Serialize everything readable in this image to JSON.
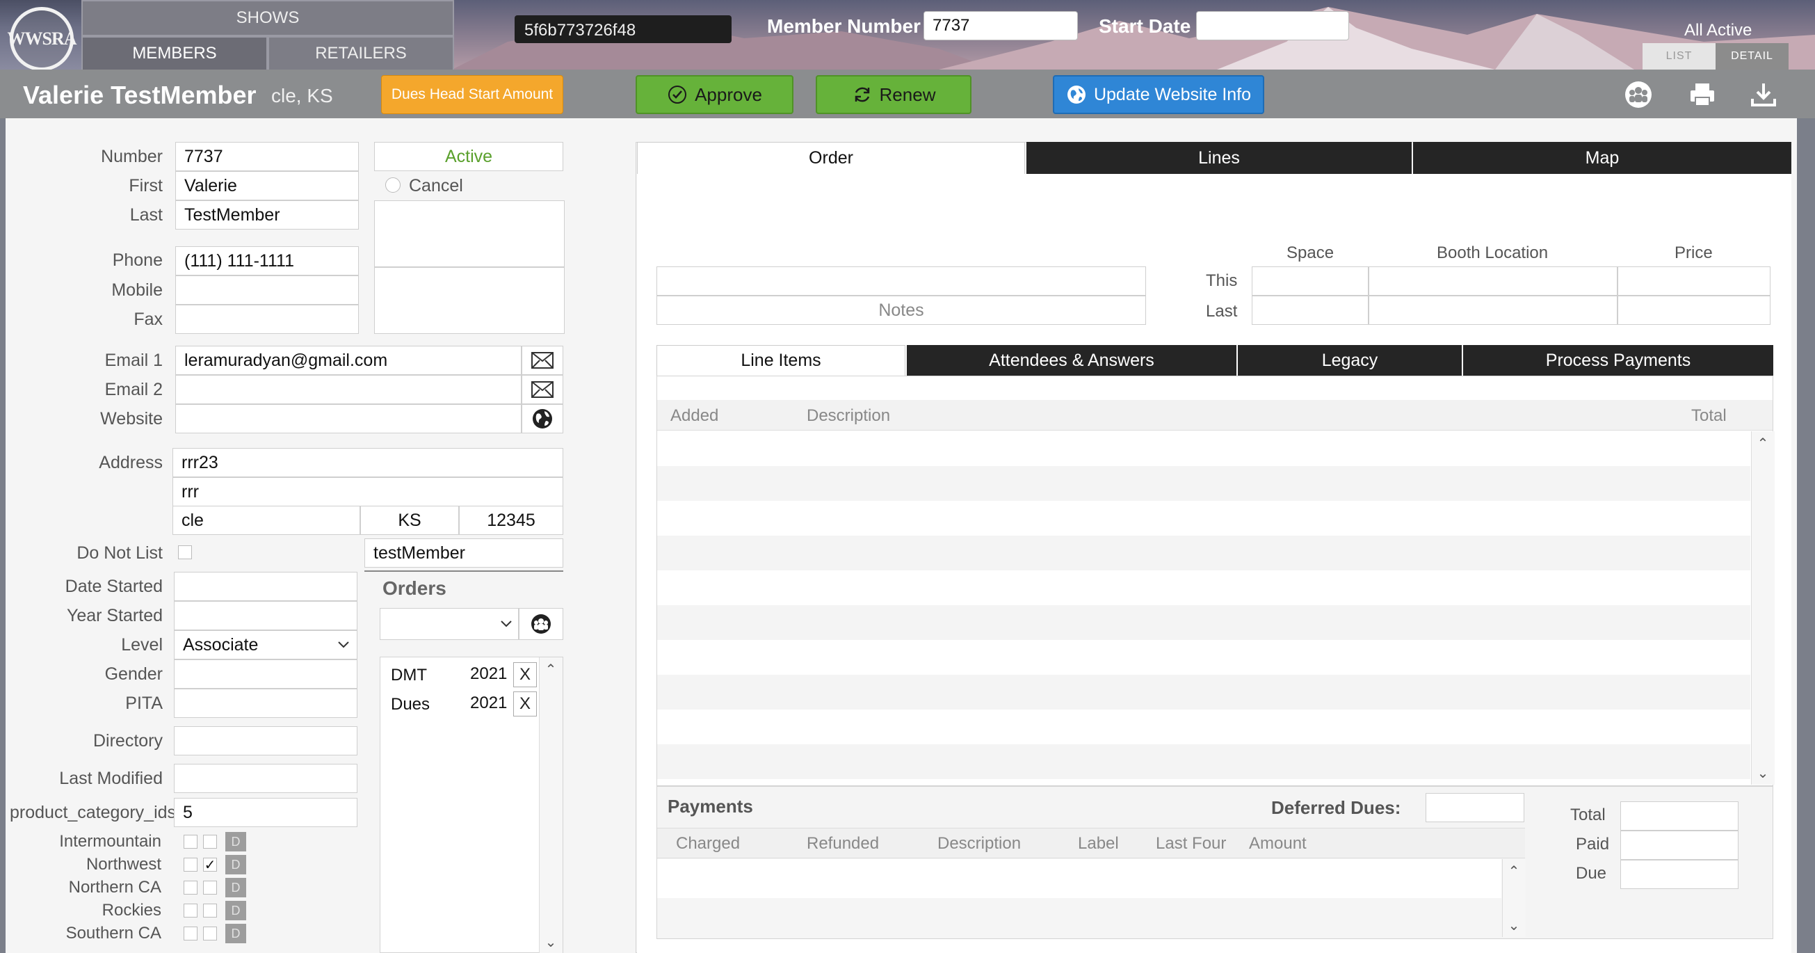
{
  "header": {
    "logo_text": "WWSRA",
    "nav_shows": "SHOWS",
    "nav_members": "MEMBERS",
    "nav_retailers": "RETAILERS",
    "record_id": "5f6b773726f48",
    "member_number_label": "Member Number",
    "member_number_value": "7737",
    "start_date_label": "Start Date",
    "start_date_value": "",
    "all_active": "All Active",
    "view_list": "LIST",
    "view_detail": "DETAIL"
  },
  "titlebar": {
    "name": "Valerie TestMember",
    "location": "cle, KS",
    "dues_btn": "Dues Head Start Amount",
    "approve_btn": "Approve",
    "renew_btn": "Renew",
    "update_btn": "Update Website Info"
  },
  "form": {
    "number_label": "Number",
    "number": "7737",
    "first_label": "First",
    "first": "Valerie",
    "last_label": "Last",
    "last": "TestMember",
    "status": "Active",
    "cancel_label": "Cancel",
    "phone_label": "Phone",
    "phone": "(111) 111-1111",
    "mobile_label": "Mobile",
    "mobile": "",
    "fax_label": "Fax",
    "fax": "",
    "email1_label": "Email 1",
    "email1": "leramuradyan@gmail.com",
    "email2_label": "Email 2",
    "email2": "",
    "website_label": "Website",
    "website": "",
    "address_label": "Address",
    "address1": "rrr23",
    "address2": "rrr",
    "city": "cle",
    "state": "KS",
    "zip": "12345",
    "do_not_list_label": "Do Not List",
    "username": "testMember",
    "date_started_label": "Date Started",
    "date_started": "",
    "year_started_label": "Year Started",
    "year_started": "",
    "level_label": "Level",
    "level": "Associate",
    "gender_label": "Gender",
    "gender": "",
    "pita_label": "PITA",
    "pita": "",
    "directory_label": "Directory",
    "directory": "",
    "last_modified_label": "Last Modified",
    "last_modified": "",
    "product_category_label": "product_category_ids",
    "product_category": "5",
    "regions": [
      {
        "name": "Intermountain",
        "checked": false
      },
      {
        "name": "Northwest",
        "checked": true
      },
      {
        "name": "Northern CA",
        "checked": false
      },
      {
        "name": "Rockies",
        "checked": false
      },
      {
        "name": "Southern CA",
        "checked": false
      }
    ],
    "region_d": "D"
  },
  "orders": {
    "title": "Orders",
    "items": [
      {
        "name": "DMT",
        "year": "2021",
        "x": "X"
      },
      {
        "name": "Dues",
        "year": "2021",
        "x": "X"
      }
    ]
  },
  "order_panel": {
    "tabs": [
      "Order",
      "Lines",
      "Map"
    ],
    "space_label": "Space",
    "booth_label": "Booth Location",
    "price_label": "Price",
    "this_label": "This",
    "last_label": "Last",
    "notes_label": "Notes",
    "subtabs": [
      "Line Items",
      "Attendees & Answers",
      "Legacy",
      "Process Payments"
    ],
    "line_cols": [
      "Added",
      "Description",
      "Total"
    ],
    "payments_title": "Payments",
    "deferred_label": "Deferred Dues:",
    "payment_cols": [
      "Charged",
      "Refunded",
      "Description",
      "Label",
      "Last Four",
      "Amount"
    ],
    "total_label": "Total",
    "paid_label": "Paid",
    "due_label": "Due"
  },
  "colors": {
    "approve": "#66b23a",
    "update": "#2f86d6",
    "dues": "#f4a72c",
    "active_text": "#5aa02c"
  }
}
